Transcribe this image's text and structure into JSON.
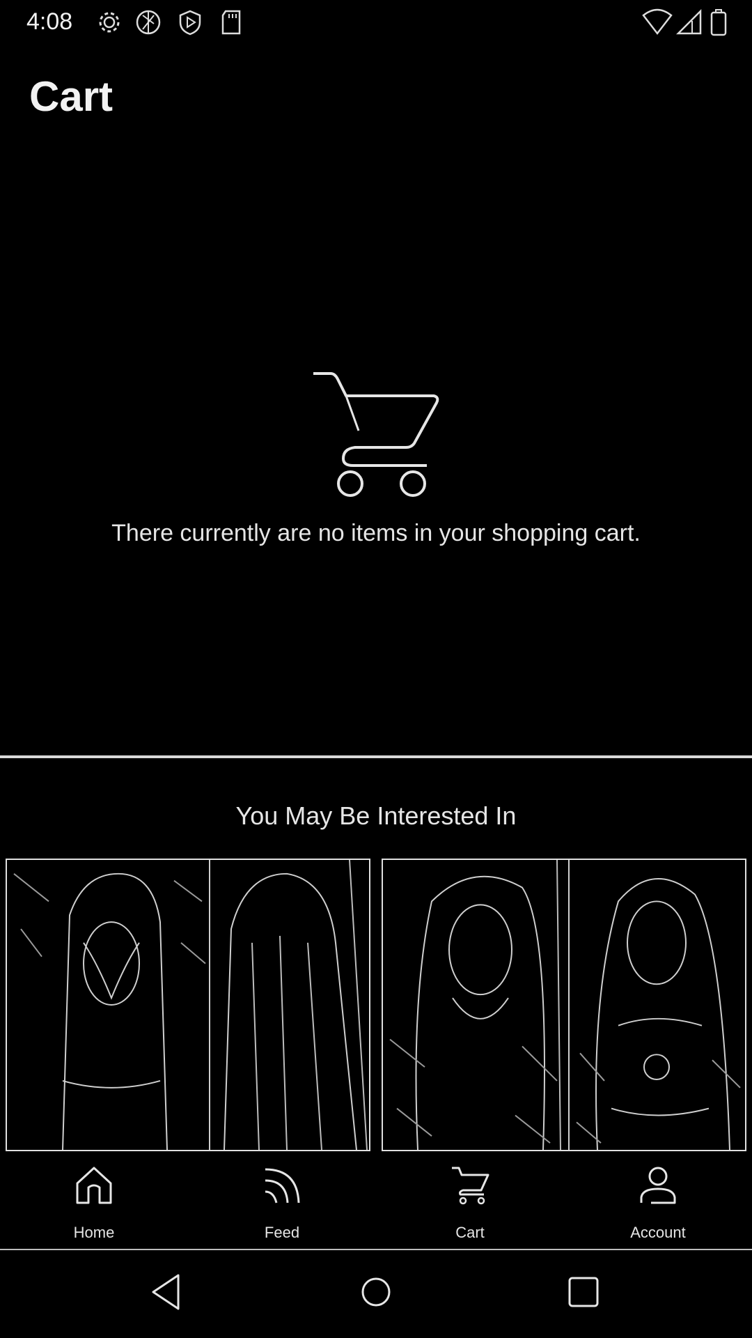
{
  "status_bar": {
    "time": "4:08",
    "left_icons": [
      "gear-icon",
      "shutter-icon",
      "play-protect-icon",
      "sd-card-icon"
    ],
    "right_icons": [
      "wifi-icon",
      "signal-icon",
      "battery-icon"
    ]
  },
  "page": {
    "title": "Cart"
  },
  "empty_state": {
    "icon": "shopping-cart-icon",
    "message": "There currently are no items in your shopping cart."
  },
  "recommendations": {
    "heading": "You May Be Interested In",
    "products": [
      {
        "name": "product-card-1",
        "photos": 2
      },
      {
        "name": "product-card-2",
        "photos": 2
      }
    ]
  },
  "bottom_nav": {
    "items": [
      {
        "label": "Home",
        "icon": "home-icon"
      },
      {
        "label": "Feed",
        "icon": "feed-icon"
      },
      {
        "label": "Cart",
        "icon": "cart-icon"
      },
      {
        "label": "Account",
        "icon": "account-icon"
      }
    ]
  },
  "system_nav": {
    "buttons": [
      "back-icon",
      "home-circle-icon",
      "recents-icon"
    ]
  },
  "colors": {
    "background": "#000000",
    "foreground": "#e6e6e6"
  }
}
